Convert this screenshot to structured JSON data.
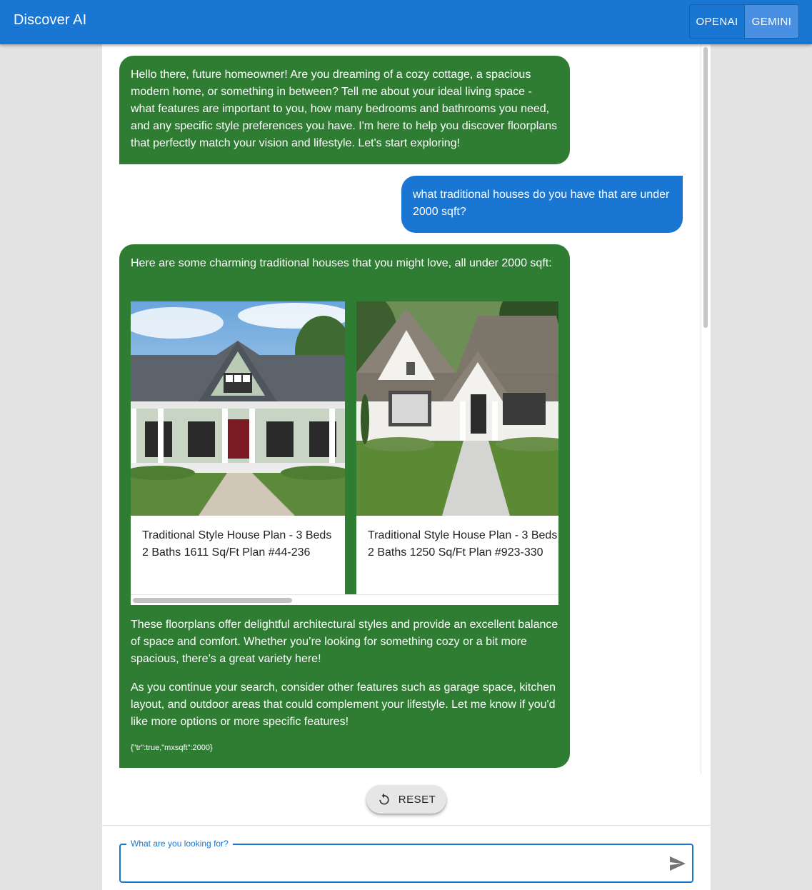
{
  "app": {
    "title": "Discover AI"
  },
  "model_toggle": {
    "options": [
      "OPENAI",
      "GEMINI"
    ],
    "selected": "GEMINI"
  },
  "chat": {
    "messages": [
      {
        "role": "assistant",
        "text": "Hello there, future homeowner! Are you dreaming of a cozy cottage, a spacious modern home, or something in between? Tell me about your ideal living space - what features are important to you, how many bedrooms and bathrooms you need, and any specific style preferences you have. I'm here to help you discover floorplans that perfectly match your vision and lifestyle. Let's start exploring!"
      },
      {
        "role": "user",
        "text": "what traditional houses do you have that are under 2000 sqft?"
      },
      {
        "role": "assistant",
        "intro": "Here are some charming traditional houses that you might love, all under 2000 sqft:",
        "cards": [
          {
            "title": "Traditional Style House Plan - 3 Beds 2 Baths 1611 Sq/Ft Plan #44-236"
          },
          {
            "title": "Traditional Style House Plan - 3 Beds 2 Baths 1250 Sq/Ft Plan #923-330"
          }
        ],
        "para1": "These floorplans offer delightful architectural styles and provide an excellent balance of space and comfort. Whether you’re looking for something cozy or a bit more spacious, there’s a great variety here!",
        "para2": "As you continue your search, consider other features such as garage space, kitchen layout, and outdoor areas that could complement your lifestyle. Let me know if you'd like more options or more specific features!",
        "meta": "{\"tr\":true,\"mxsqft\":2000}"
      }
    ]
  },
  "reset": {
    "label": "RESET",
    "icon": "refresh-icon"
  },
  "search": {
    "label": "What are you looking for?",
    "value": "",
    "icon": "send-icon"
  },
  "colors": {
    "primary": "#1976d2",
    "assistant_bubble": "#2e7d32",
    "user_bubble": "#1976d2"
  }
}
